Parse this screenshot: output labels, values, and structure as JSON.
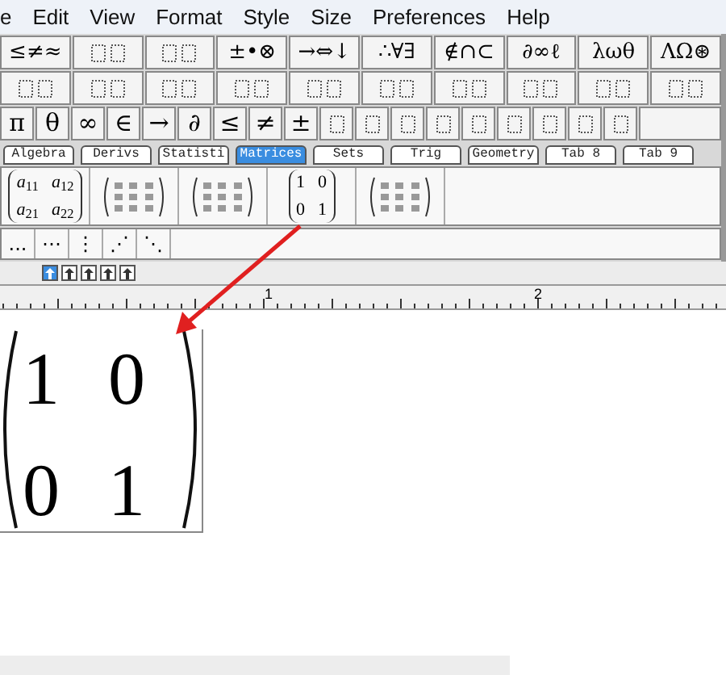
{
  "menu": [
    "e",
    "Edit",
    "View",
    "Format",
    "Style",
    "Size",
    "Preferences",
    "Help"
  ],
  "palette_row_1": [
    {
      "kind": "text",
      "label": "≤≠≈"
    },
    {
      "kind": "template"
    },
    {
      "kind": "template"
    },
    {
      "kind": "text",
      "label": "±•⊗"
    },
    {
      "kind": "text",
      "label": "→⇔↓"
    },
    {
      "kind": "text",
      "label": "∴∀∃"
    },
    {
      "kind": "text",
      "label": "∉∩⊂"
    },
    {
      "kind": "text",
      "label": "∂∞ℓ"
    },
    {
      "kind": "text",
      "label": "λωθ"
    },
    {
      "kind": "text",
      "label": "ΛΩ⊛"
    }
  ],
  "palette_row_2": [
    {
      "kind": "template"
    },
    {
      "kind": "template"
    },
    {
      "kind": "template"
    },
    {
      "kind": "template"
    },
    {
      "kind": "template"
    },
    {
      "kind": "template"
    },
    {
      "kind": "template"
    },
    {
      "kind": "template"
    },
    {
      "kind": "template"
    },
    {
      "kind": "template"
    }
  ],
  "palette_row_3": [
    {
      "kind": "text",
      "label": "π"
    },
    {
      "kind": "text",
      "label": "θ"
    },
    {
      "kind": "text",
      "label": "∞"
    },
    {
      "kind": "text",
      "label": "∈"
    },
    {
      "kind": "text",
      "label": "→"
    },
    {
      "kind": "text",
      "label": "∂"
    },
    {
      "kind": "text",
      "label": "≤"
    },
    {
      "kind": "text",
      "label": "≠"
    },
    {
      "kind": "text",
      "label": "±"
    },
    {
      "kind": "template"
    },
    {
      "kind": "template"
    },
    {
      "kind": "template"
    },
    {
      "kind": "template"
    },
    {
      "kind": "template"
    },
    {
      "kind": "template"
    },
    {
      "kind": "template"
    },
    {
      "kind": "template"
    },
    {
      "kind": "template"
    }
  ],
  "tabs": [
    {
      "label": "Algebra",
      "selected": false
    },
    {
      "label": "Derivs",
      "selected": false
    },
    {
      "label": "Statisti",
      "selected": false
    },
    {
      "label": "Matrices",
      "selected": true
    },
    {
      "label": "Sets",
      "selected": false
    },
    {
      "label": "Trig",
      "selected": false
    },
    {
      "label": "Geometry",
      "selected": false
    },
    {
      "label": "Tab 8",
      "selected": false
    },
    {
      "label": "Tab 9",
      "selected": false
    }
  ],
  "matrix_templates": [
    {
      "kind": "matrix",
      "cells": [
        "*a*$_{11}$",
        "*a*$_{12}$",
        "*a*$_{21}$",
        "*a*$_{22}$"
      ]
    },
    {
      "kind": "template"
    },
    {
      "kind": "template"
    },
    {
      "kind": "matrix",
      "cells": [
        "1",
        "0",
        "0",
        "1"
      ]
    },
    {
      "kind": "template"
    }
  ],
  "dot_templates": [
    "...",
    "⋯",
    "⋮",
    "⋰",
    "⋱"
  ],
  "nudge_buttons": [
    {
      "selected": true
    },
    {
      "selected": false
    },
    {
      "selected": false
    },
    {
      "selected": false
    },
    {
      "selected": false
    }
  ],
  "ruler": {
    "labels": [
      "1",
      "2"
    ]
  },
  "equation": {
    "cells": [
      "1",
      "0",
      "0",
      "1"
    ]
  }
}
